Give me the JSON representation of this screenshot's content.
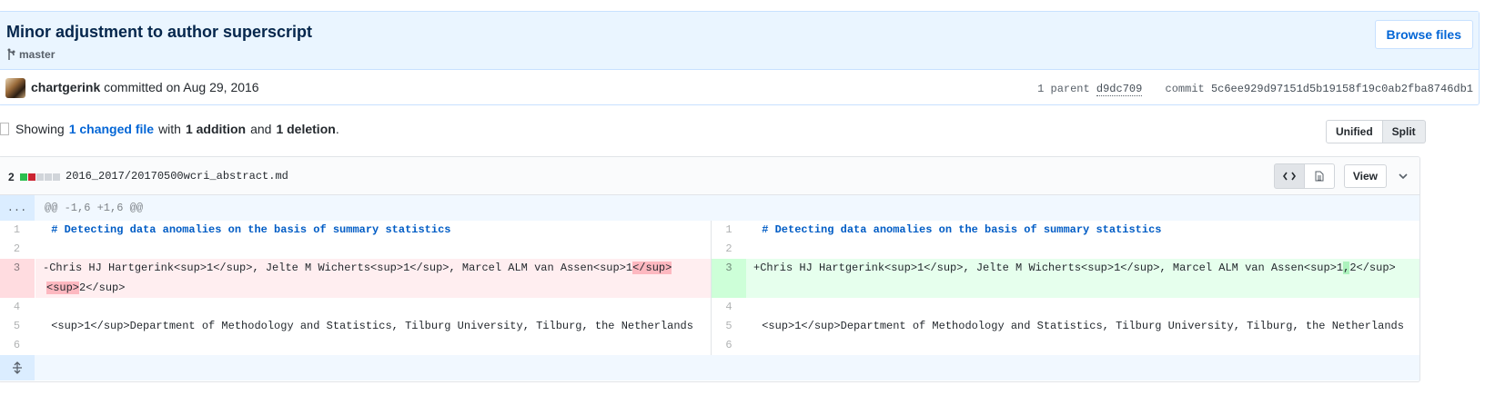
{
  "commit": {
    "title": "Minor adjustment to author superscript",
    "branch": "master",
    "browse_label": "Browse files",
    "author": "chartgerink",
    "committed_text": "committed on Aug 29, 2016",
    "parent_label": "1 parent",
    "parent_sha": "d9dc709",
    "commit_label": "commit",
    "commit_sha": "5c6ee929d97151d5b19158f19c0ab2fba8746db1"
  },
  "toc": {
    "showing": "Showing",
    "changed_files": "1 changed file",
    "with": "with",
    "additions": "1 addition",
    "and": "and",
    "deletions": "1 deletion",
    "period": "."
  },
  "view_toggle": {
    "unified": "Unified",
    "split": "Split"
  },
  "file": {
    "change_count": "2",
    "path": "2016_2017/20170500wcri_abstract.md",
    "view_label": "View",
    "hunk_expander": "...",
    "hunk_header": "@@ -1,6 +1,6 @@"
  },
  "lines": {
    "l1": {
      "num": "1",
      "text": "# Detecting data anomalies on the basis of summary statistics"
    },
    "l2": {
      "num": "2",
      "text": ""
    },
    "l3_left": {
      "num": "3",
      "prefix": "-Chris HJ Hartgerink<sup>1</sup>, Jelte M Wicherts<sup>1</sup>, Marcel ALM van Assen<sup>1",
      "removed": "</sup>",
      "removed2": "<sup>",
      "suffix": "2</sup>"
    },
    "l3_right": {
      "num": "3",
      "prefix": "+Chris HJ Hartgerink<sup>1</sup>, Jelte M Wicherts<sup>1</sup>, Marcel ALM van Assen<sup>1",
      "added": ",",
      "suffix": "2</sup>"
    },
    "l4": {
      "num": "4",
      "text": ""
    },
    "l5": {
      "num": "5",
      "text": "<sup>1</sup>Department of Methodology and Statistics, Tilburg University, Tilburg, the Netherlands"
    },
    "l6": {
      "num": "6",
      "text": ""
    }
  },
  "colors": {
    "commit_header_bg": "#eaf5ff",
    "link": "#0366d6",
    "deletion_bg": "#ffeef0",
    "addition_bg": "#e6ffed",
    "deletion_highlight": "#fdb8c0",
    "addition_highlight": "#acf2bd"
  }
}
